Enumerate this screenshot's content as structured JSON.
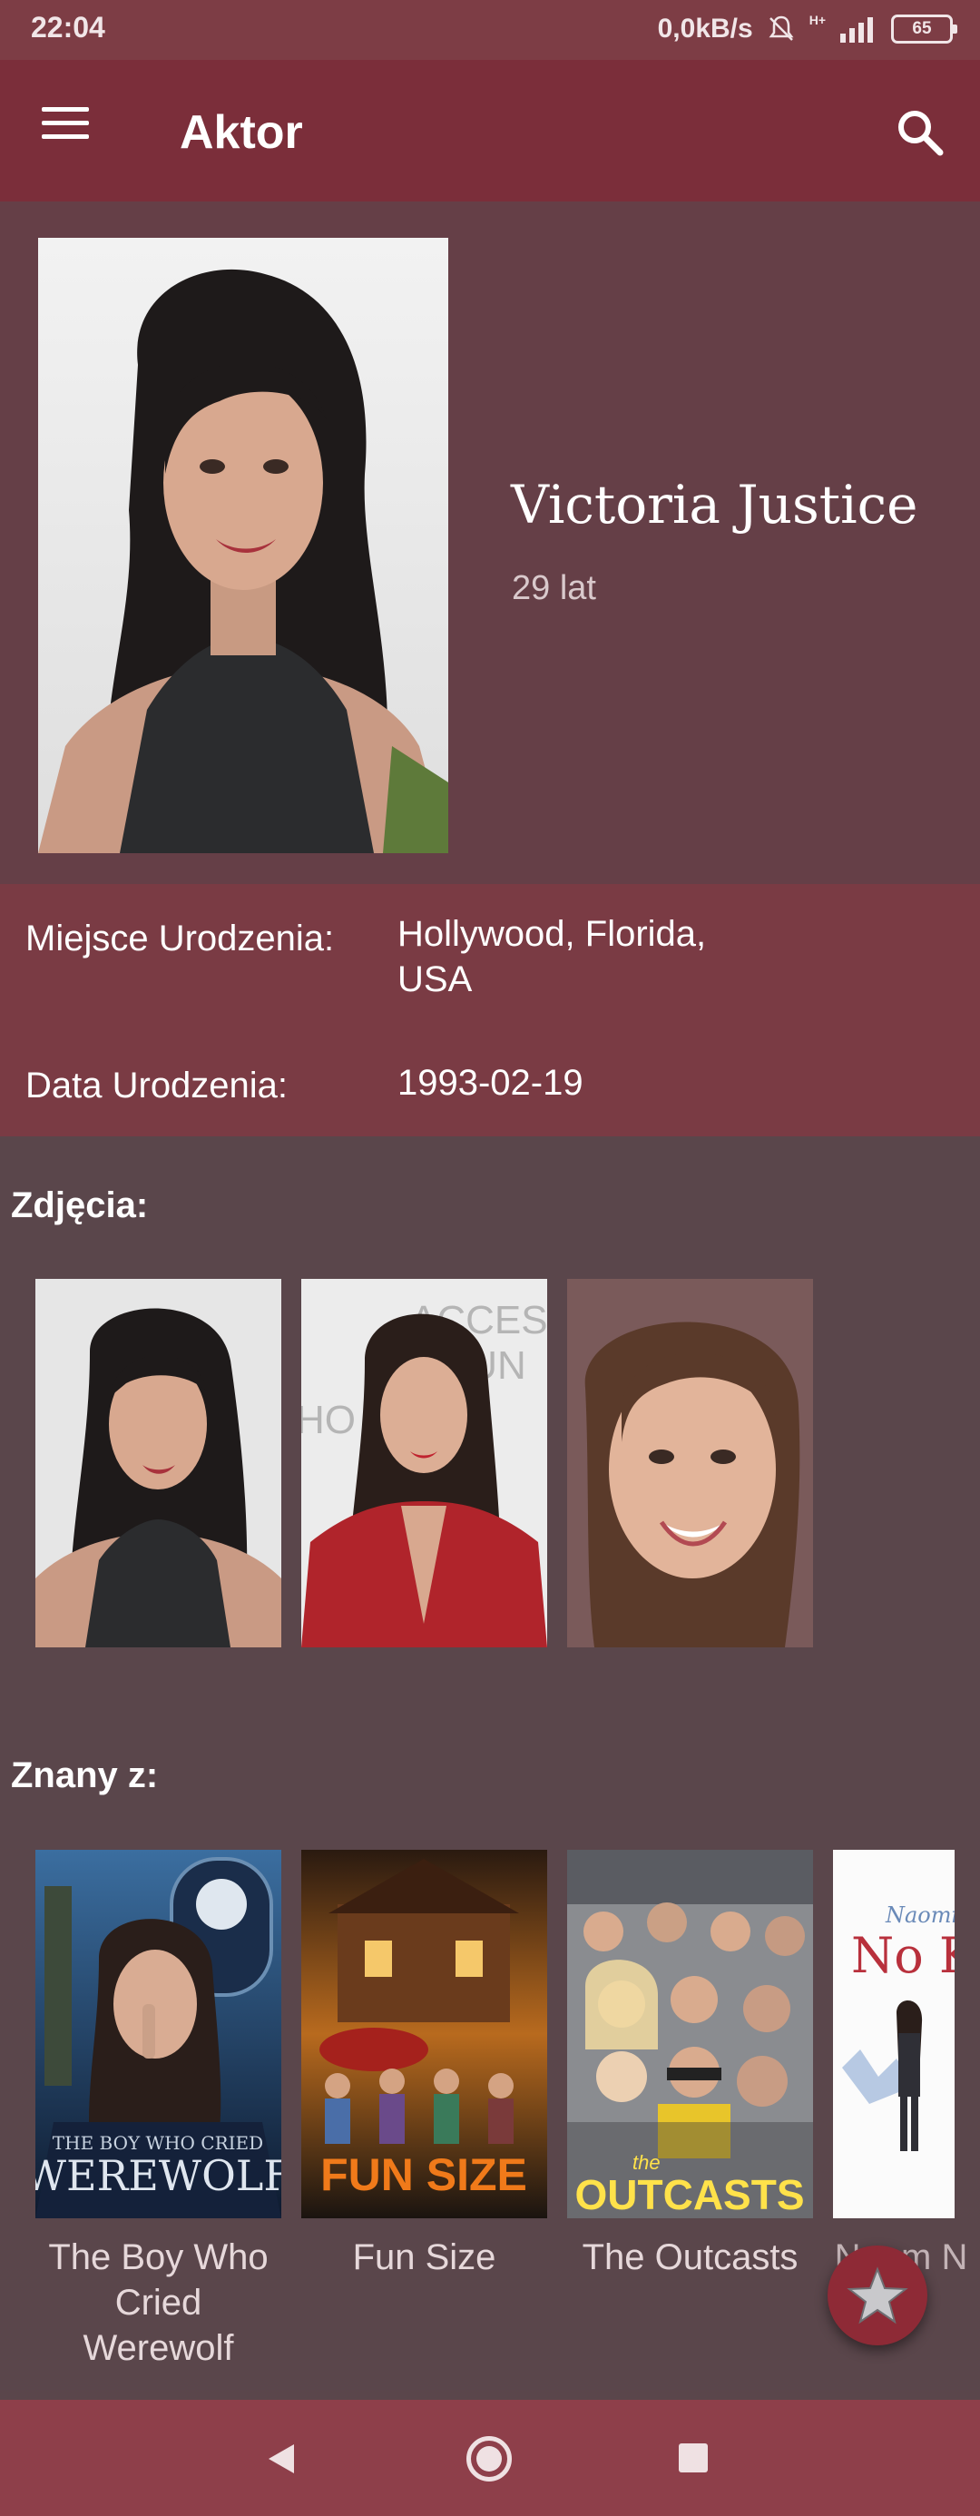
{
  "status_bar": {
    "time": "22:04",
    "speed": "0,0kB/s",
    "network": "H+",
    "battery": "65"
  },
  "toolbar": {
    "title": "Aktor",
    "menu_icon": "hamburger-menu-icon",
    "search_icon": "search-icon"
  },
  "actor": {
    "name": "Victoria Justice",
    "age": "29 lat",
    "birthplace_label": "Miejsce Urodzenia:",
    "birthplace_value": "Hollywood, Florida, USA",
    "birthdate_label": "Data Urodzenia:",
    "birthdate_value": "1993-02-19"
  },
  "photos": {
    "title": "Zdjęcia:"
  },
  "known_for": {
    "title": "Znany z:",
    "movies": [
      {
        "title": "The Boy Who Cried Werewolf",
        "poster_text": [
          "THE BOY WHO CRIED",
          "WEREWOLF"
        ]
      },
      {
        "title": "Fun Size",
        "poster_text": [
          "FUN SIZE"
        ]
      },
      {
        "title": "The Outcasts",
        "poster_text": [
          "the",
          "OUTCASTS"
        ]
      },
      {
        "title": "Naomi and Ely's No Kiss List",
        "title_partial": "Naom N Li",
        "poster_text": [
          "Naomi",
          "No Ki"
        ]
      }
    ]
  },
  "fab": {
    "icon": "star-icon"
  },
  "navigation": {
    "back_icon": "back-icon",
    "home_icon": "home-icon",
    "recents_icon": "recents-icon"
  },
  "colors": {
    "toolbar": "#7b2e3a",
    "status_bar": "#7d3d45",
    "background": "#5a464b",
    "header": "#653f47",
    "info": "#7a3b44",
    "nav": "#8e3f4a"
  }
}
